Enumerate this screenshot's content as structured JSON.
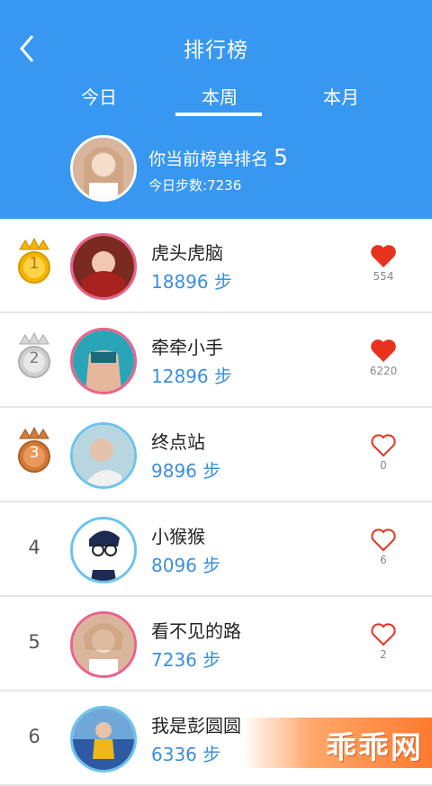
{
  "header": {
    "title": "排行榜",
    "tabs": [
      {
        "label": "今日"
      },
      {
        "label": "本周"
      },
      {
        "label": "本月"
      }
    ],
    "active_tab": "本周",
    "me": {
      "rank_label": "你当前榜单排名",
      "rank_value": "5",
      "steps_label": "今日步数:",
      "steps_value": "7236"
    }
  },
  "list": [
    {
      "rank": "1",
      "medal": "gold",
      "name": "虎头虎脑",
      "steps": "18896",
      "unit": "步",
      "likes": "554",
      "liked": true,
      "avatar_color": "#c0302f"
    },
    {
      "rank": "2",
      "medal": "silver",
      "name": "牵牵小手",
      "steps": "12896",
      "unit": "步",
      "likes": "6220",
      "liked": true,
      "avatar_color": "#2aa5b8"
    },
    {
      "rank": "3",
      "medal": "bronze",
      "name": "终点站",
      "steps": "9896",
      "unit": "步",
      "likes": "0",
      "liked": false,
      "avatar_color": "#b9d6e0"
    },
    {
      "rank": "4",
      "medal": "",
      "name": "小猴猴",
      "steps": "8096",
      "unit": "步",
      "likes": "6",
      "liked": false,
      "avatar_color": "#ffffff"
    },
    {
      "rank": "5",
      "medal": "",
      "name": "看不见的路",
      "steps": "7236",
      "unit": "步",
      "likes": "2",
      "liked": false,
      "avatar_color": "#d9b59b"
    },
    {
      "rank": "6",
      "medal": "",
      "name": "我是彭圆圆",
      "steps": "6336",
      "unit": "步",
      "likes": "",
      "liked": false,
      "avatar_color": "#2e5aa3"
    }
  ],
  "watermark": {
    "text": "乖乖网"
  },
  "colors": {
    "header": "#3897f0",
    "steps": "#3b8fdc",
    "heart": "#e8321e",
    "gold": "#f5b400",
    "silver": "#cfcfcf",
    "bronze": "#d27a3a"
  }
}
